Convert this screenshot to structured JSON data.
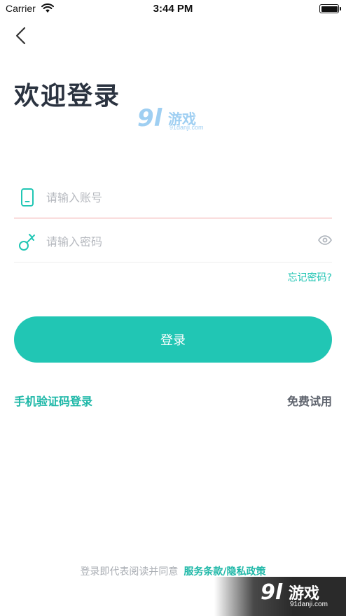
{
  "status_bar": {
    "carrier": "Carrier",
    "time": "3:44 PM",
    "icons": [
      "wifi-icon",
      "battery-icon"
    ]
  },
  "nav": {
    "back_icon": "chevron-left-icon"
  },
  "page": {
    "title": "欢迎登录"
  },
  "watermark": {
    "logo_num": "9l",
    "logo_text": "游戏",
    "url": "91danji.com"
  },
  "form": {
    "account": {
      "icon": "phone-icon",
      "value": "",
      "placeholder": "请输入账号"
    },
    "password": {
      "icon": "key-icon",
      "value": "",
      "placeholder": "请输入密码",
      "toggle_icon": "eye-icon"
    },
    "forgot_label": "忘记密码?",
    "login_label": "登录"
  },
  "links": {
    "sms_login": "手机验证码登录",
    "free_trial": "免费试用"
  },
  "agreement": {
    "text": "登录即代表阅读并同意",
    "link": "服务条款/隐私政策"
  },
  "colors": {
    "accent": "#21c6b4",
    "title": "#2b3340",
    "error_underline": "#f2a3a3",
    "placeholder": "#b6b9bf"
  }
}
